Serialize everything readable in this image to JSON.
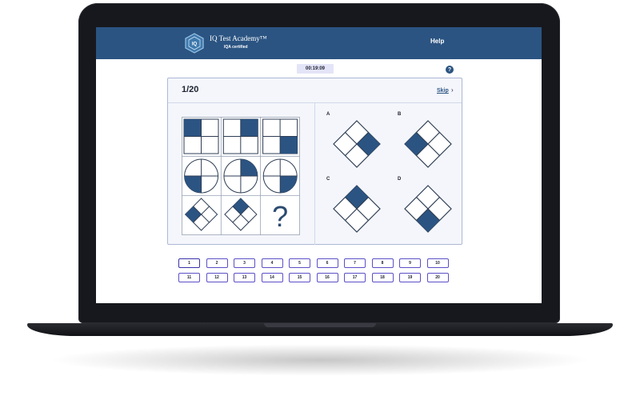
{
  "header": {
    "brand_name": "IQ Test Academy™",
    "brand_tagline": "IQA certified",
    "logo_text": "IQ",
    "help_label": "Help"
  },
  "timer": {
    "value": "00:19:09"
  },
  "help_icon_glyph": "?",
  "question": {
    "counter": "1/20",
    "skip_label": "Skip",
    "skip_chevron_glyph": "›",
    "unknown_glyph": "?",
    "options": [
      {
        "letter": "A"
      },
      {
        "letter": "B"
      },
      {
        "letter": "C"
      },
      {
        "letter": "D"
      }
    ]
  },
  "navigator": {
    "current": "1",
    "buttons": [
      "1",
      "2",
      "3",
      "4",
      "5",
      "6",
      "7",
      "8",
      "9",
      "10",
      "11",
      "12",
      "13",
      "14",
      "15",
      "16",
      "17",
      "18",
      "19",
      "20"
    ]
  },
  "colors": {
    "header_bg": "#2b5482",
    "shape_fill": "#2b5482",
    "card_bg": "#f4f6fb",
    "nav_border": "#5b4fc7"
  }
}
